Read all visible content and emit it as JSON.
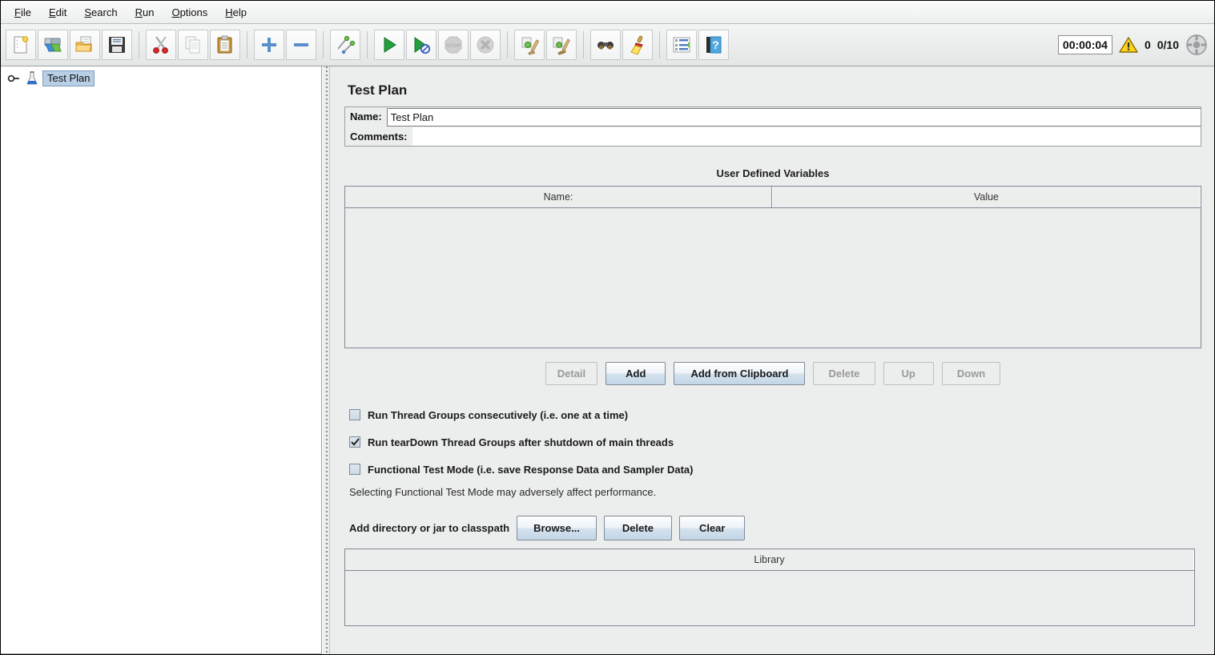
{
  "menu": {
    "items": [
      {
        "label": "File",
        "mnemonic": "F"
      },
      {
        "label": "Edit",
        "mnemonic": "E"
      },
      {
        "label": "Search",
        "mnemonic": "S"
      },
      {
        "label": "Run",
        "mnemonic": "R"
      },
      {
        "label": "Options",
        "mnemonic": "O"
      },
      {
        "label": "Help",
        "mnemonic": "H"
      }
    ]
  },
  "toolbar": {
    "groups": [
      {
        "buttons": [
          {
            "name": "new-icon",
            "title": "New",
            "enabled": true
          },
          {
            "name": "templates-icon",
            "title": "Templates",
            "enabled": true
          },
          {
            "name": "open-icon",
            "title": "Open",
            "enabled": true
          },
          {
            "name": "save-icon",
            "title": "Save Test Plan",
            "enabled": true
          }
        ]
      },
      {
        "buttons": [
          {
            "name": "cut-icon",
            "title": "Cut",
            "enabled": true
          },
          {
            "name": "copy-icon",
            "title": "Copy",
            "enabled": false
          },
          {
            "name": "paste-icon",
            "title": "Paste",
            "enabled": true
          }
        ]
      },
      {
        "buttons": [
          {
            "name": "expand-all-icon",
            "title": "Expand All",
            "enabled": true
          },
          {
            "name": "collapse-all-icon",
            "title": "Collapse All",
            "enabled": true
          }
        ]
      },
      {
        "buttons": [
          {
            "name": "toggle-icon",
            "title": "Toggle",
            "enabled": true
          }
        ]
      },
      {
        "buttons": [
          {
            "name": "start-icon",
            "title": "Start",
            "enabled": true
          },
          {
            "name": "start-no-pauses-icon",
            "title": "Start no pauses",
            "enabled": true
          },
          {
            "name": "stop-icon",
            "title": "Stop",
            "enabled": false
          },
          {
            "name": "shutdown-icon",
            "title": "Shutdown",
            "enabled": false
          }
        ]
      },
      {
        "buttons": [
          {
            "name": "clear-icon",
            "title": "Clear",
            "enabled": true
          },
          {
            "name": "clear-all-icon",
            "title": "Clear All",
            "enabled": true
          }
        ]
      },
      {
        "buttons": [
          {
            "name": "search-icon",
            "title": "Search",
            "enabled": true
          },
          {
            "name": "search-reset-icon",
            "title": "Reset Search",
            "enabled": true
          }
        ]
      },
      {
        "buttons": [
          {
            "name": "function-helper-icon",
            "title": "Function Helper Dialog",
            "enabled": true
          },
          {
            "name": "help-icon",
            "title": "Help",
            "enabled": true
          }
        ]
      }
    ]
  },
  "status": {
    "timer": "00:00:04",
    "warning_count": "0",
    "thread_count": "0/10",
    "warning_icon": "warning-triangle-icon",
    "remote_icon": "remote-connection-icon"
  },
  "tree": {
    "nodes": [
      {
        "label": "Test Plan",
        "icon": "test-plan-flask-icon",
        "selected": true,
        "expand_handle": "expand-key-handle"
      }
    ]
  },
  "main": {
    "title": "Test Plan",
    "name_label": "Name:",
    "name_value": "Test Plan",
    "comments_label": "Comments:",
    "comments_value": "",
    "comments_placeholder": "",
    "udv": {
      "section_title": "User Defined Variables",
      "columns": [
        "Name:",
        "Value"
      ],
      "rows": []
    },
    "udv_buttons": [
      {
        "label": "Detail",
        "enabled": false,
        "name": "detail-button"
      },
      {
        "label": "Add",
        "enabled": true,
        "name": "add-button"
      },
      {
        "label": "Add from Clipboard",
        "enabled": true,
        "name": "add-from-clipboard-button"
      },
      {
        "label": "Delete",
        "enabled": false,
        "name": "delete-button"
      },
      {
        "label": "Up",
        "enabled": false,
        "name": "up-button"
      },
      {
        "label": "Down",
        "enabled": false,
        "name": "down-button"
      }
    ],
    "checkboxes": [
      {
        "label": "Run Thread Groups consecutively (i.e. one at a time)",
        "checked": false,
        "name": "run-thread-groups-consecutively-checkbox"
      },
      {
        "label": "Run tearDown Thread Groups after shutdown of main threads",
        "checked": true,
        "name": "run-teardown-thread-groups-checkbox"
      },
      {
        "label": "Functional Test Mode (i.e. save Response Data and Sampler Data)",
        "checked": false,
        "name": "functional-test-mode-checkbox"
      }
    ],
    "functional_note": "Selecting Functional Test Mode may adversely affect performance.",
    "classpath": {
      "label": "Add directory or jar to classpath",
      "buttons": [
        {
          "label": "Browse...",
          "enabled": true,
          "name": "browse-button"
        },
        {
          "label": "Delete",
          "enabled": true,
          "name": "classpath-delete-button"
        },
        {
          "label": "Clear",
          "enabled": true,
          "name": "classpath-clear-button"
        }
      ],
      "table": {
        "columns": [
          "Library"
        ],
        "rows": []
      }
    }
  },
  "colors": {
    "panel_bg": "#eceded",
    "tree_bg": "#ffffff",
    "selection_blue": "#b8cfe5",
    "border_gray": "#9aa0a2",
    "accent_button": "#c3d6e7",
    "warning_yellow": "#f2c200",
    "start_green": "#22a03c"
  }
}
